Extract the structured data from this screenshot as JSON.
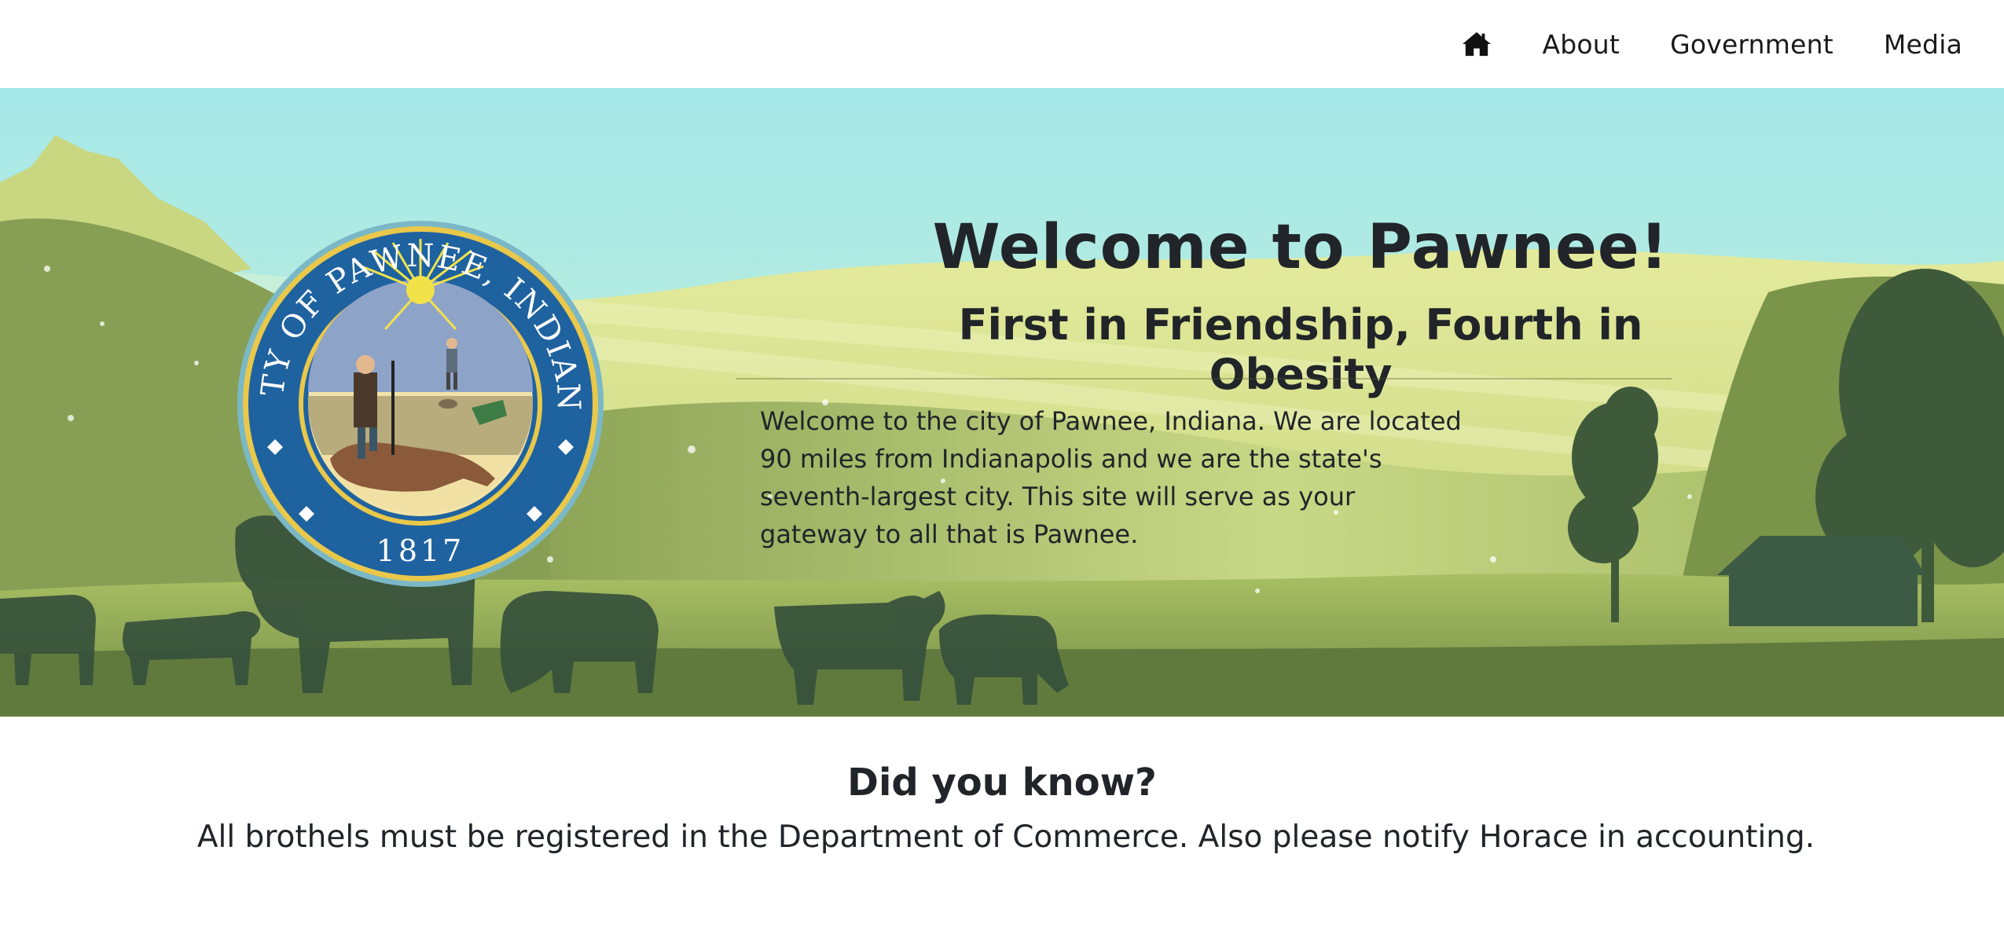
{
  "nav": {
    "home_icon": "home-icon",
    "items": [
      {
        "label": "About"
      },
      {
        "label": "Government"
      },
      {
        "label": "Media"
      }
    ]
  },
  "hero": {
    "title": "Welcome to Pawnee!",
    "subtitle": "First in Friendship, Fourth in Obesity",
    "body": "Welcome to the city of Pawnee, Indiana. We are located 90 miles from Indianapolis and we are the state's seventh-largest city. This site will serve as your gateway to all that is Pawnee.",
    "seal": {
      "ring_text": "CITY OF PAWNEE, INDIANA",
      "year": "1817"
    }
  },
  "did_you_know": {
    "title": "Did you know?",
    "text": "All brothels must be registered in the Department of Commerce. Also please notify Horace in accounting."
  },
  "colors": {
    "sky": "#a9e6e6",
    "hills_light": "#d9e494",
    "hills_mid": "#a9bf63",
    "silhouette": "#3f5a3b",
    "seal_blue": "#1f62a0",
    "seal_gold": "#e9c84a",
    "text": "#212529"
  }
}
